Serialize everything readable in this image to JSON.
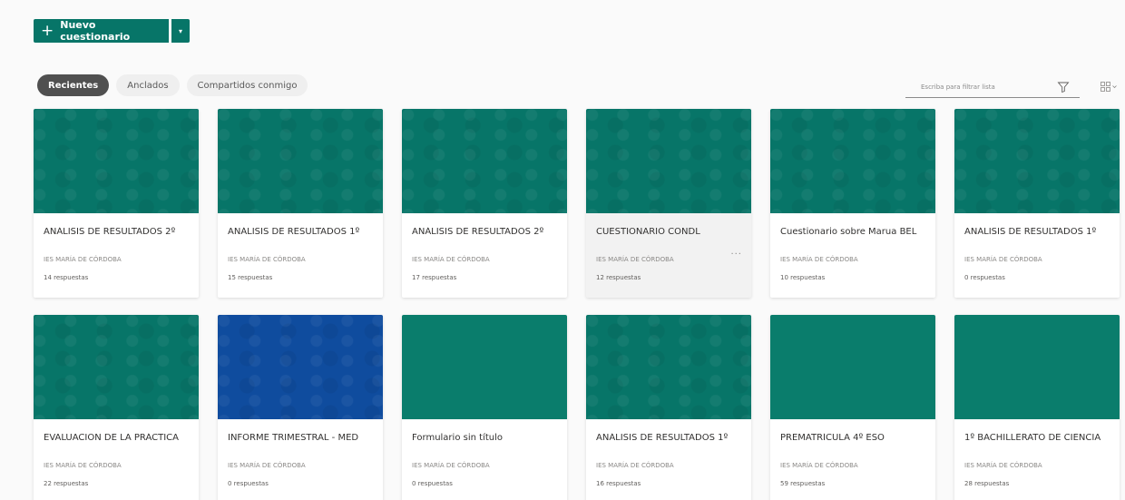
{
  "toolbar": {
    "new_button_label": "Nuevo cuestionario",
    "new_button_icon": "plus-icon",
    "split_icon": "chevron-down-icon"
  },
  "tabs": [
    {
      "label": "Recientes",
      "active": true
    },
    {
      "label": "Anclados",
      "active": false
    },
    {
      "label": "Compartidos conmigo",
      "active": false
    }
  ],
  "filter": {
    "placeholder": "Escriba para filtrar lista",
    "icon": "filter-icon"
  },
  "view_toggle_icon": "grid-view-icon",
  "colors": {
    "accent": "#077568",
    "teal": "#077568",
    "green": "#0a7d6c",
    "blue": "#0f4c9e"
  },
  "cards": [
    {
      "title": "ANÁLISIS DE RESULTADOS 2º",
      "org": "IES MARÍA DE CÓRDOBA",
      "responses": "14 respuestas",
      "color": "#077568"
    },
    {
      "title": "ANÁLISIS DE RESULTADOS 1º",
      "org": "IES MARÍA DE CÓRDOBA",
      "responses": "15 respuestas",
      "color": "#077568"
    },
    {
      "title": "ANÁLISIS DE RESULTADOS 2º",
      "org": "IES MARÍA DE CÓRDOBA",
      "responses": "17 respuestas",
      "color": "#077568"
    },
    {
      "title": "CUESTIONARIO CONDL",
      "org": "IES MARÍA DE CÓRDOBA",
      "responses": "12 respuestas",
      "color": "#077568",
      "hover": true,
      "more": "···"
    },
    {
      "title": "Cuestionario sobre Marua BEL",
      "org": "IES MARÍA DE CÓRDOBA",
      "responses": "10 respuestas",
      "color": "#077568"
    },
    {
      "title": "ANÁLISIS DE RESULTADOS 1º",
      "org": "IES MARÍA DE CÓRDOBA",
      "responses": "0 respuestas",
      "color": "#077568"
    },
    {
      "title": "EVALUACIÓN DE LA PRÁCTICA",
      "org": "IES MARÍA DE CÓRDOBA",
      "responses": "22 respuestas",
      "color": "#077568"
    },
    {
      "title": "INFORME TRIMESTRAL - MED",
      "org": "IES MARÍA DE CÓRDOBA",
      "responses": "0 respuestas",
      "color": "#0f4c9e"
    },
    {
      "title": "Formulario sin título",
      "org": "IES MARÍA DE CÓRDOBA",
      "responses": "0 respuestas",
      "color": "#0a7d6c"
    },
    {
      "title": "ANÁLISIS DE RESULTADOS 1º",
      "org": "IES MARÍA DE CÓRDOBA",
      "responses": "16 respuestas",
      "color": "#077568"
    },
    {
      "title": "PREMATRÍCULA 4º ESO",
      "org": "IES MARÍA DE CÓRDOBA",
      "responses": "59 respuestas",
      "color": "#0a7d6c"
    },
    {
      "title": "1º BACHILLERATO DE CIENCIA",
      "org": "IES MARÍA DE CÓRDOBA",
      "responses": "28 respuestas",
      "color": "#0a7d6c"
    }
  ]
}
